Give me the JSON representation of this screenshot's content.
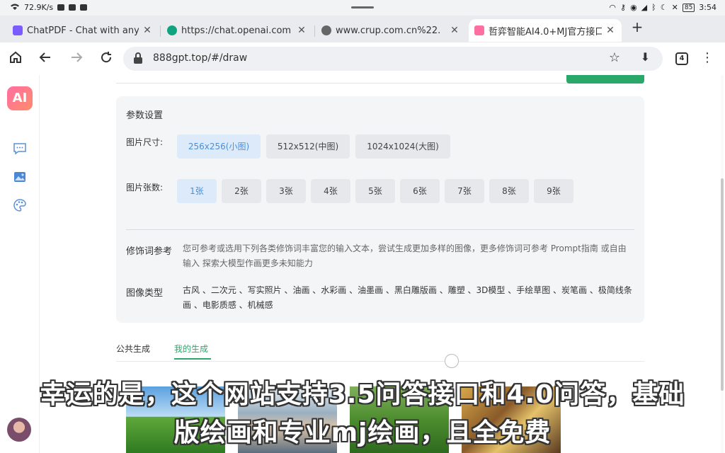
{
  "status_bar": {
    "speed": "72.9K/s",
    "battery": "85",
    "time": "3:54"
  },
  "tabs": [
    {
      "title": "ChatPDF - Chat with any PDF",
      "favicon": "chatpdf-icon",
      "color": "#7b5cff"
    },
    {
      "title": "https://chat.openai.com",
      "favicon": "openai-icon",
      "color": "#10a37f"
    },
    {
      "title": "www.crup.com.cn%22.",
      "favicon": "globe-icon",
      "color": "#555555"
    },
    {
      "title": "哲弈智能AI4.0+MJ官方接口",
      "favicon": "ai-icon",
      "color": "#ff6ea1"
    }
  ],
  "omnibox": {
    "url": "888gpt.top/#/draw",
    "tab_count": "4"
  },
  "sidebar": {
    "logo": "AI",
    "items": [
      {
        "icon": "chat-bubble-icon"
      },
      {
        "icon": "image-icon"
      },
      {
        "icon": "palette-icon"
      }
    ]
  },
  "params": {
    "title": "参数设置",
    "size_label": "图片尺寸:",
    "sizes": [
      "256x256(小图)",
      "512x512(中图)",
      "1024x1024(大图)"
    ],
    "selected_size": "256x256(小图)",
    "count_label": "图片张数:",
    "counts": [
      "1张",
      "2张",
      "3张",
      "4张",
      "5张",
      "6张",
      "7张",
      "8张",
      "9张"
    ],
    "selected_count": "1张",
    "modifier_label": "修饰词参考",
    "modifier_text": "您可参考或选用下列各类修饰词丰富您的输入文本，尝试生成更加多样的图像，更多修饰词可参考 Prompt指南 或自由输入 探索大模型作画更多未知能力",
    "type_label": "图像类型",
    "types_text": "古风 、二次元 、写实照片 、油画 、水彩画 、油墨画 、黑白雕版画 、雕塑 、3D模型 、手绘草图 、炭笔画 、极简线条画 、电影质感 、机械感"
  },
  "gallery_tabs": {
    "public": "公共生成",
    "mine": "我的生成",
    "active": "mine"
  },
  "subtitles": {
    "line1": "幸运的是，这个网站支持3.5问答接口和4.0问答，基础",
    "line2": "版绘画和专业mj绘画，且全免费"
  },
  "colors": {
    "accent_green": "#29a86a",
    "selected_blue": "#4a90d9"
  }
}
